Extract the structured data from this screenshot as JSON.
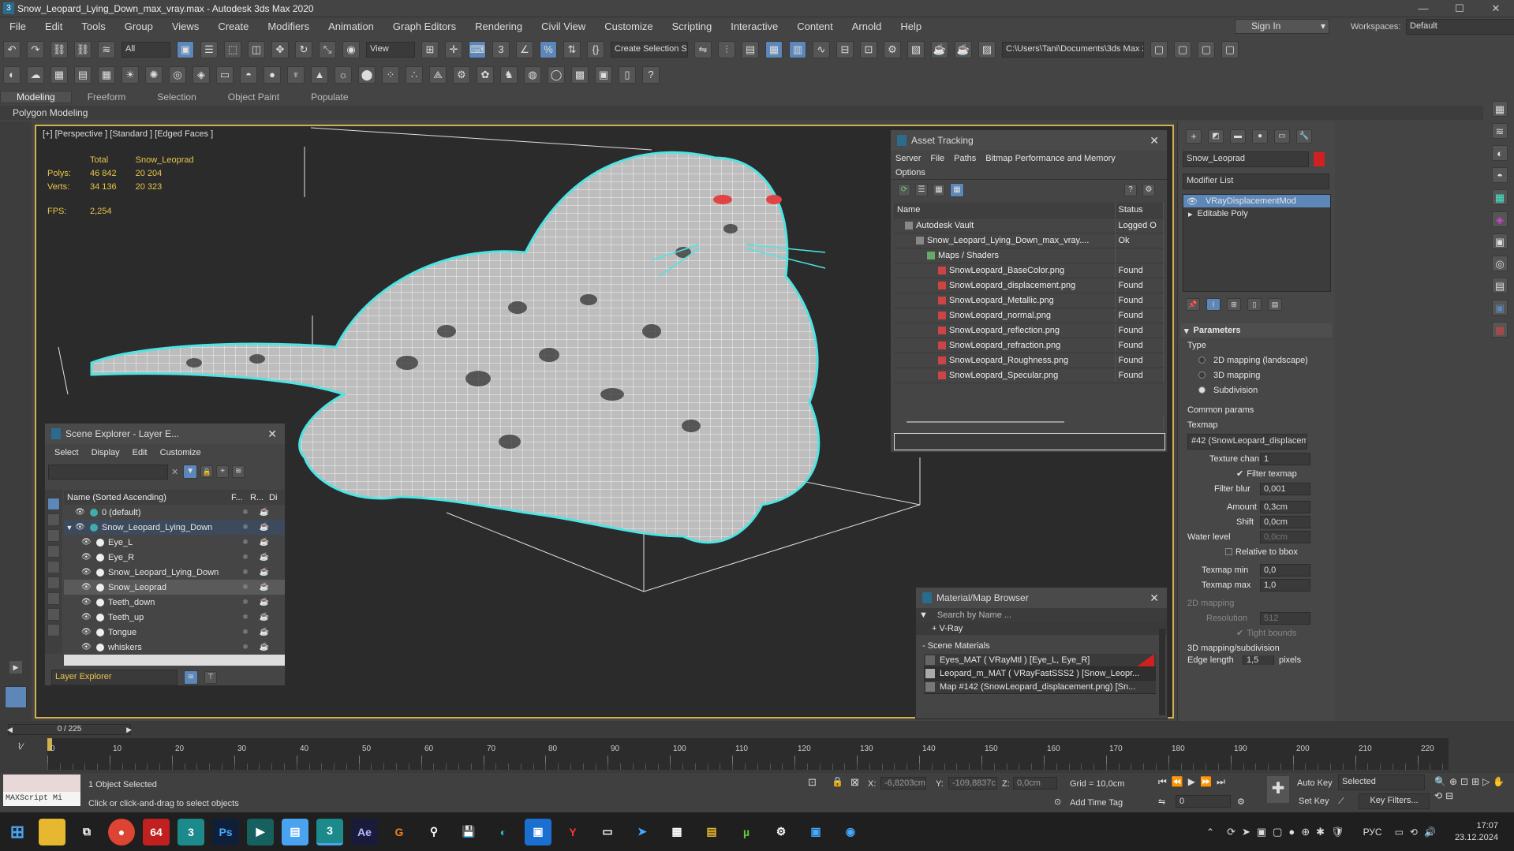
{
  "window": {
    "title": "Snow_Leopard_Lying_Down_max_vray.max - Autodesk 3ds Max 2020",
    "min": "—",
    "max": "☐",
    "close": "✕"
  },
  "menu": [
    "File",
    "Edit",
    "Tools",
    "Group",
    "Views",
    "Create",
    "Modifiers",
    "Animation",
    "Graph Editors",
    "Rendering",
    "Civil View",
    "Customize",
    "Scripting",
    "Interactive",
    "Content",
    "Arnold",
    "Help"
  ],
  "signin": "Sign In",
  "workspaces_label": "Workspaces:",
  "workspace": "Default",
  "toolbar": {
    "filter": "All",
    "view": "View",
    "selset": "Create Selection Se",
    "path": "C:\\Users\\Tani\\Documents\\3ds Max 2020"
  },
  "ribbon": {
    "tabs": [
      "Modeling",
      "Freeform",
      "Selection",
      "Object Paint",
      "Populate"
    ],
    "sub": "Polygon Modeling"
  },
  "viewport": {
    "label": "[+] [Perspective ] [Standard ] [Edged Faces ]",
    "stats": {
      "h1": "Total",
      "h2": "Snow_Leoprad",
      "polys_l": "Polys:",
      "polys_t": "46 842",
      "polys_s": "20 204",
      "verts_l": "Verts:",
      "verts_t": "34 136",
      "verts_s": "20 323",
      "fps_l": "FPS:",
      "fps": "2,254"
    }
  },
  "asset_tracking": {
    "title": "Asset Tracking",
    "menu": [
      "Server",
      "File",
      "Paths",
      "Bitmap Performance and Memory"
    ],
    "options": "Options",
    "col_name": "Name",
    "col_status": "Status",
    "rows": [
      {
        "name": "Autodesk Vault",
        "status": "Logged O",
        "indent": 1
      },
      {
        "name": "Snow_Leopard_Lying_Down_max_vray....",
        "status": "Ok",
        "indent": 2
      },
      {
        "name": "Maps / Shaders",
        "status": "",
        "indent": 3
      },
      {
        "name": "SnowLeopard_BaseColor.png",
        "status": "Found",
        "indent": 4
      },
      {
        "name": "SnowLeopard_displacement.png",
        "status": "Found",
        "indent": 4
      },
      {
        "name": "SnowLeopard_Metallic.png",
        "status": "Found",
        "indent": 4
      },
      {
        "name": "SnowLeopard_normal.png",
        "status": "Found",
        "indent": 4
      },
      {
        "name": "SnowLeopard_reflection.png",
        "status": "Found",
        "indent": 4
      },
      {
        "name": "SnowLeopard_refraction.png",
        "status": "Found",
        "indent": 4
      },
      {
        "name": "SnowLeopard_Roughness.png",
        "status": "Found",
        "indent": 4
      },
      {
        "name": "SnowLeopard_Specular.png",
        "status": "Found",
        "indent": 4
      }
    ]
  },
  "scene_explorer": {
    "title": "Scene Explorer - Layer E...",
    "menu": [
      "Select",
      "Display",
      "Edit",
      "Customize"
    ],
    "col_name": "Name (Sorted Ascending)",
    "col_f": "F...",
    "col_r": "R...",
    "col_d": "Di",
    "rows": [
      {
        "name": "0 (default)",
        "level": 0
      },
      {
        "name": "Snow_Leopard_Lying_Down",
        "level": 0
      },
      {
        "name": "Eye_L",
        "level": 1
      },
      {
        "name": "Eye_R",
        "level": 1
      },
      {
        "name": "Snow_Leopard_Lying_Down",
        "level": 1
      },
      {
        "name": "Snow_Leoprad",
        "level": 1
      },
      {
        "name": "Teeth_down",
        "level": 1
      },
      {
        "name": "Teeth_up",
        "level": 1
      },
      {
        "name": "Tongue",
        "level": 1
      },
      {
        "name": "whiskers",
        "level": 1
      }
    ],
    "footer": "Layer Explorer"
  },
  "material_browser": {
    "title": "Material/Map Browser",
    "search": "Search by Name ...",
    "vray": "+ V-Ray",
    "section": "- Scene Materials",
    "items": [
      "Eyes_MAT ( VRayMtl ) [Eye_L, Eye_R]",
      "Leopard_m_MAT ( VRayFastSSS2 ) [Snow_Leopr...",
      "Map #142 (SnowLeopard_displacement.png) [Sn..."
    ]
  },
  "command_panel": {
    "object_name": "Snow_Leoprad",
    "modifier_list": "Modifier List",
    "stack": [
      "VRayDisplacementMod",
      "Editable Poly"
    ],
    "params": {
      "title": "Parameters",
      "type": "Type",
      "r1": "2D mapping (landscape)",
      "r2": "3D mapping",
      "r3": "Subdivision",
      "common": "Common params",
      "texmap": "Texmap",
      "texmap_val": "#42 (SnowLeopard_displaceme",
      "texture_chan": "Texture chan",
      "texture_chan_v": "1",
      "filter_texmap": "Filter texmap",
      "filter_blur": "Filter blur",
      "filter_blur_v": "0,001",
      "amount": "Amount",
      "amount_v": "0,3cm",
      "shift": "Shift",
      "shift_v": "0,0cm",
      "water": "Water level",
      "water_v": "0,0cm",
      "relative": "Relative to bbox",
      "tmin": "Texmap min",
      "tmin_v": "0,0",
      "tmax": "Texmap max",
      "tmax_v": "1,0",
      "map2d": "2D mapping",
      "resolution": "Resolution",
      "resolution_v": "512",
      "tight": "Tight bounds",
      "map3d": "3D mapping/subdivision",
      "edge": "Edge length",
      "edge_v": "1,5",
      "pixels": "pixels"
    }
  },
  "timeline": {
    "frame": "0 / 225",
    "ticks": [
      "0",
      "10",
      "20",
      "30",
      "40",
      "50",
      "60",
      "70",
      "80",
      "90",
      "100",
      "110",
      "120",
      "130",
      "140",
      "150",
      "160",
      "170",
      "180",
      "190",
      "200",
      "210",
      "220"
    ]
  },
  "status": {
    "maxscript": "MAXScript Mi",
    "selected": "1 Object Selected",
    "hint": "Click or click-and-drag to select objects",
    "x_label": "X:",
    "x": "-6,8203cm",
    "y_label": "Y:",
    "y": "-109,8837c",
    "z_label": "Z:",
    "z": "0,0cm",
    "grid": "Grid = 10,0cm",
    "addtag": "Add Time Tag",
    "autokey": "Auto Key",
    "setkey": "Set Key",
    "selected_dd": "Selected",
    "keyfilters": "Key Filters...",
    "frame_spin": "0"
  },
  "taskbar": {
    "lang": "РУС",
    "time": "17:07",
    "date": "23.12.2024",
    "apps": [
      "start",
      "explorer",
      "taskview",
      "chrome",
      "app64",
      "3dsmax",
      "photoshop",
      "app2",
      "notepad",
      "3dsmax2",
      "aftereffects",
      "app3",
      "app4",
      "save",
      "edge",
      "app5",
      "yandex",
      "terminal",
      "app6",
      "calc",
      "app7",
      "utorrent",
      "settings",
      "app8",
      "app9"
    ]
  },
  "colors": {
    "accent": "#d2b04c",
    "select": "#5c87b8",
    "wire": "#4ee4e4"
  }
}
